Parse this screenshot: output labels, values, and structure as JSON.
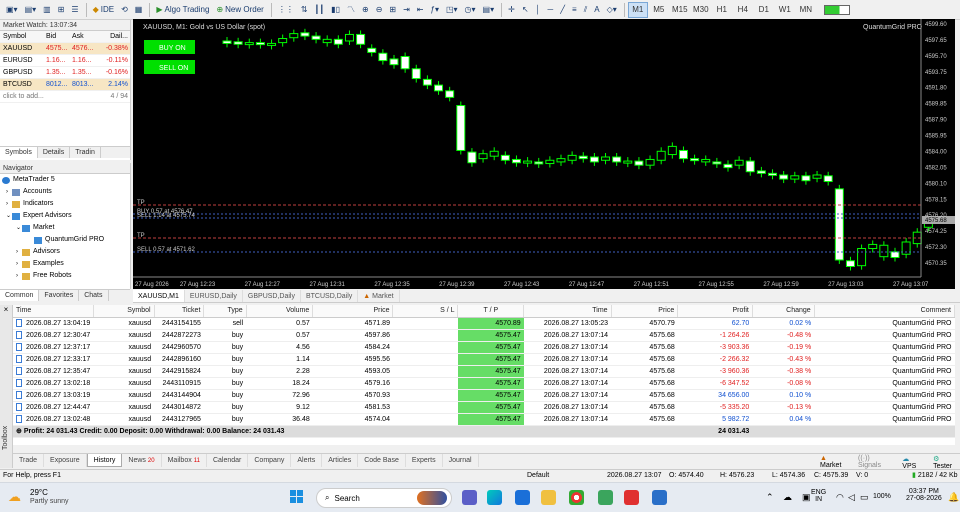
{
  "toolbar": {
    "algo_label": "Algo Trading",
    "neworder_label": "New Order",
    "ide_label": "IDE",
    "timeframes": [
      "M1",
      "M5",
      "M15",
      "M30",
      "H1",
      "H4",
      "D1",
      "W1",
      "MN"
    ],
    "active_tf": "M1"
  },
  "market_watch": {
    "title": "Market Watch: 13:07:34",
    "headers": [
      "Symbol",
      "Bid",
      "Ask",
      "Dail..."
    ],
    "rows": [
      {
        "symbol": "XAUUSD",
        "bid": "4575...",
        "ask": "4576...",
        "daily": "-0.38%",
        "neg": true
      },
      {
        "symbol": "EURUSD",
        "bid": "1.16...",
        "ask": "1.16...",
        "daily": "-0.11%",
        "neg": true
      },
      {
        "symbol": "GBPUSD",
        "bid": "1.35...",
        "ask": "1.35...",
        "daily": "-0.16%",
        "neg": true
      },
      {
        "symbol": "BTCUSD",
        "bid": "8012...",
        "ask": "8013...",
        "daily": "2.14%",
        "neg": false
      }
    ],
    "add_label": "click to add...",
    "count": "4 / 94",
    "tabs": [
      "Symbols",
      "Details",
      "Tradin"
    ]
  },
  "navigator": {
    "title": "Navigator",
    "items": [
      "MetaTrader 5",
      "Accounts",
      "Indicators",
      "Expert Advisors",
      "Market",
      "QuantumGrid PRO",
      "Advisors",
      "Examples",
      "Free Robots"
    ],
    "tabs": [
      "Common",
      "Favorites",
      "Chats"
    ]
  },
  "chart": {
    "title": "XAUUSD, M1:  Gold vs US Dollar (spot)",
    "ea_name": "QuantumGrid PRO",
    "buy_btn": "BUY ON",
    "sell_btn": "SELL ON",
    "price_labels": [
      "4599.60",
      "4597.65",
      "4595.70",
      "4593.75",
      "4591.80",
      "4589.85",
      "4587.90",
      "4585.95",
      "4584.00",
      "4582.05",
      "4580.10",
      "4578.15",
      "4576.20",
      "4574.25",
      "4572.30",
      "4570.35"
    ],
    "time_labels": [
      "27 Aug 2026",
      "27 Aug 12:23",
      "27 Aug 12:27",
      "27 Aug 12:31",
      "27 Aug 12:35",
      "27 Aug 12:39",
      "27 Aug 12:43",
      "27 Aug 12:47",
      "27 Aug 12:51",
      "27 Aug 12:55",
      "27 Aug 12:59",
      "27 Aug 13:03",
      "27 Aug 13:07"
    ],
    "lines": [
      "TP",
      "BUY 0.57 at 4576.47",
      "SELL 1.14 at 4575.74",
      "TP",
      "SELL 0.57 at 4571.62"
    ],
    "current_price": "4575.68",
    "colors": {
      "bull": "#00ff00",
      "bear": "#ffffff"
    }
  },
  "chart_tabs": [
    "XAUUSD,M1",
    "EURUSD,Daily",
    "GBPUSD,Daily",
    "BTCUSD,Daily",
    "Market"
  ],
  "trade": {
    "headers": [
      "Time",
      "Symbol",
      "Ticket",
      "Type",
      "Volume",
      "Price",
      "S / L",
      "T / P",
      "Time",
      "Price",
      "Profit",
      "Change",
      "Comment"
    ],
    "rows": [
      [
        "2026.08.27 13:04:19",
        "xauusd",
        "2443154155",
        "sell",
        "0.57",
        "4571.89",
        "",
        "4570.89",
        "2026.08.27 13:05:23",
        "4570.79",
        "62.70",
        "0.02 %",
        "QuantumGrid PRO"
      ],
      [
        "2026.08.27 12:30:47",
        "xauusd",
        "2442872273",
        "buy",
        "0.57",
        "4597.86",
        "",
        "4575.47",
        "2026.08.27 13:07:14",
        "4575.68",
        "-1 264.26",
        "-0.48 %",
        "QuantumGrid PRO"
      ],
      [
        "2026.08.27 12:37:17",
        "xauusd",
        "2442960570",
        "buy",
        "4.56",
        "4584.24",
        "",
        "4575.47",
        "2026.08.27 13:07:14",
        "4575.68",
        "-3 903.36",
        "-0.19 %",
        "QuantumGrid PRO"
      ],
      [
        "2026.08.27 12:33:17",
        "xauusd",
        "2442896160",
        "buy",
        "1.14",
        "4595.56",
        "",
        "4575.47",
        "2026.08.27 13:07:14",
        "4575.68",
        "-2 266.32",
        "-0.43 %",
        "QuantumGrid PRO"
      ],
      [
        "2026.08.27 12:35:47",
        "xauusd",
        "2442915824",
        "buy",
        "2.28",
        "4593.05",
        "",
        "4575.47",
        "2026.08.27 13:07:14",
        "4575.68",
        "-3 960.36",
        "-0.38 %",
        "QuantumGrid PRO"
      ],
      [
        "2026.08.27 13:02:18",
        "xauusd",
        "2443110915",
        "buy",
        "18.24",
        "4579.16",
        "",
        "4575.47",
        "2026.08.27 13:07:14",
        "4575.68",
        "-6 347.52",
        "-0.08 %",
        "QuantumGrid PRO"
      ],
      [
        "2026.08.27 13:03:19",
        "xauusd",
        "2443144904",
        "buy",
        "72.96",
        "4570.93",
        "",
        "4575.47",
        "2026.08.27 13:07:14",
        "4575.68",
        "34 656.00",
        "0.10 %",
        "QuantumGrid PRO"
      ],
      [
        "2026.08.27 12:44:47",
        "xauusd",
        "2443014872",
        "buy",
        "9.12",
        "4581.53",
        "",
        "4575.47",
        "2026.08.27 13:07:14",
        "4575.68",
        "-5 335.20",
        "-0.13 %",
        "QuantumGrid PRO"
      ],
      [
        "2026.08.27 13:02:48",
        "xauusd",
        "2443127965",
        "buy",
        "36.48",
        "4574.04",
        "",
        "4575.47",
        "2026.08.27 13:07:14",
        "4575.68",
        "5 982.72",
        "0.04 %",
        "QuantumGrid PRO"
      ]
    ],
    "summary": "Profit: 24 031.43  Credit: 0.00  Deposit: 0.00  Withdrawal: 0.00  Balance: 24 031.43",
    "summary_profit": "24 031.43"
  },
  "bottom_tabs": [
    {
      "label": "Trade",
      "badge": ""
    },
    {
      "label": "Exposure",
      "badge": ""
    },
    {
      "label": "History",
      "badge": ""
    },
    {
      "label": "News",
      "badge": "20"
    },
    {
      "label": "Mailbox",
      "badge": "11"
    },
    {
      "label": "Calendar",
      "badge": ""
    },
    {
      "label": "Company",
      "badge": ""
    },
    {
      "label": "Alerts",
      "badge": ""
    },
    {
      "label": "Articles",
      "badge": ""
    },
    {
      "label": "Code Base",
      "badge": ""
    },
    {
      "label": "Experts",
      "badge": ""
    },
    {
      "label": "Journal",
      "badge": ""
    }
  ],
  "bottom_right": [
    "Market",
    "Signals",
    "VPS",
    "Tester"
  ],
  "toolbox_label": "Toolbox",
  "status": {
    "help": "For Help, press F1",
    "profile": "Default",
    "datetime": "2026.08.27 13:07",
    "open": "O: 4574.40",
    "high": "H: 4576.23",
    "low": "L: 4574.36",
    "close": "C: 4575.39",
    "volume": "V: 0",
    "traffic": "2182 / 42 Kb"
  },
  "taskbar": {
    "temp": "29°C",
    "weather": "Partly sunny",
    "search": "Search",
    "lang1": "ENG",
    "lang2": "IN",
    "battery": "100%",
    "time": "03:37 PM",
    "date": "27-08-2026"
  }
}
